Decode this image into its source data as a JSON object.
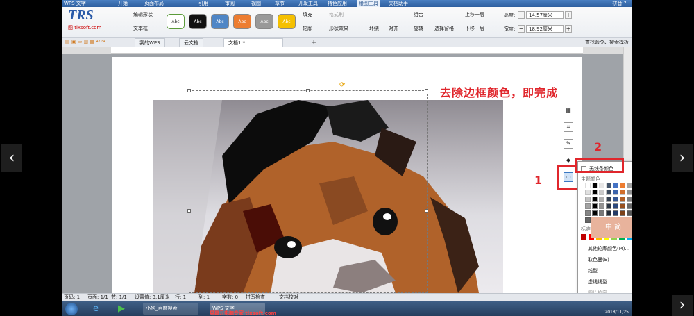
{
  "menubar": {
    "app_name": "WPS 文字",
    "items": [
      "开始",
      "页面布局",
      "引用",
      "审阅",
      "视图",
      "章节",
      "开发工具",
      "特色应用",
      "绘图工具",
      "文档助手"
    ],
    "active": "绘图工具",
    "right": "拼音 ？·"
  },
  "ribbon": {
    "logo_big": "TRS",
    "logo_small": "图 tlxsoft.com",
    "edit_shape": "编辑形状",
    "textbox": "文本框",
    "swatch_label": "Abc",
    "fill": "填充",
    "format_brush": "格式刷",
    "outline": "轮廓",
    "shape_effect": "形状效果",
    "wrap": "环绕",
    "align": "对齐",
    "group": "组合",
    "rotate": "旋转",
    "select_pane": "选择窗格",
    "bring_forward": "上移一层",
    "send_backward": "下移一层",
    "height_label": "高度:",
    "height_value": "14.57厘米",
    "width_label": "宽度:",
    "width_value": "18.92厘米",
    "swatch_colors": [
      "#ffffff",
      "#111111",
      "#4f86c6",
      "#ed7d31",
      "#999999",
      "#f5c000"
    ]
  },
  "tabbar": {
    "tabs": [
      "我的WPS",
      "云文档",
      "文档1 *"
    ],
    "search": "查找命令、搜索模板"
  },
  "document": {
    "annotation": "去除边框颜色，即完成",
    "step1": "1",
    "step2": "2"
  },
  "popup": {
    "no_line": "无线条颜色",
    "theme_colors": "主题颜色",
    "standard_colors": "标准色",
    "more_colors": "其他轮廓颜色(M)...",
    "eyedropper": "取色器(E)",
    "line_style": "线型",
    "dash_style": "虚线线型",
    "image_outline": "图片轮廓",
    "theme_palette": [
      "#ffffff",
      "#000000",
      "#e7e6e6",
      "#44546a",
      "#4472c4",
      "#ed7d31",
      "#a5a5a5",
      "#ffc000",
      "#5b9bd5",
      "#70ad47"
    ],
    "standard_palette": [
      "#c00000",
      "#ff0000",
      "#ffc000",
      "#ffff00",
      "#92d050",
      "#00b050",
      "#00b0f0",
      "#0070c0",
      "#002060",
      "#7030a0"
    ]
  },
  "ime": {
    "label": "中 简"
  },
  "statusbar": {
    "items": [
      "页码: 1",
      "页面: 1/1",
      "节: 1/1",
      "设置值: 3.1厘米",
      "行: 1",
      "列: 1",
      "字数: 0",
      "拼写检查",
      "文档校对"
    ]
  },
  "taskbar": {
    "buttons": [
      "小狗_百度搜索",
      "WPS 文字"
    ],
    "watermark": "易嘉云电脑专家 tlxsoft.com",
    "clock": "2018/11/25"
  },
  "nav": {
    "prev": "‹",
    "next": "›"
  }
}
